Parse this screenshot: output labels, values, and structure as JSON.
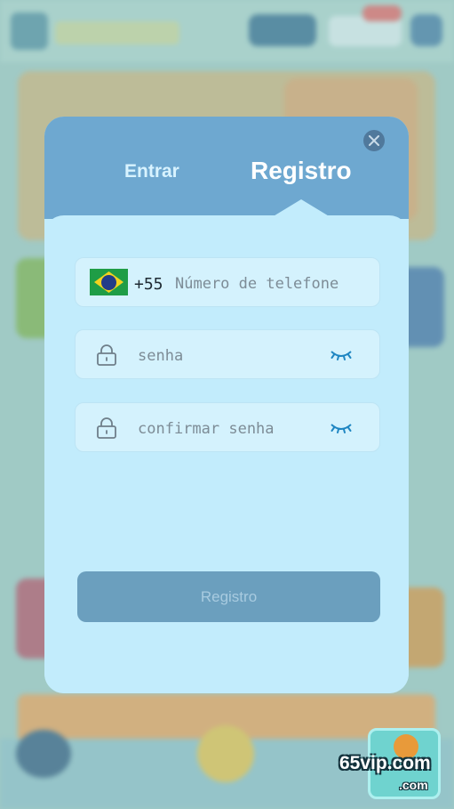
{
  "tabs": {
    "login_label": "Entrar",
    "register_label": "Registro"
  },
  "phone": {
    "country_code": "+55",
    "placeholder": "Número de telefone",
    "flag": "brazil-flag-icon"
  },
  "password": {
    "placeholder": "senha",
    "icon": "lock-icon",
    "toggle_icon": "eye-closed-icon"
  },
  "confirm_password": {
    "placeholder": "confirmar senha",
    "icon": "lock-icon",
    "toggle_icon": "eye-closed-icon"
  },
  "submit": {
    "label": "Registro"
  },
  "watermark": {
    "text": "65vip.com",
    "sub": ".com"
  },
  "colors": {
    "header": "#6ea8d0",
    "panel": "#c2ecfc",
    "button": "#6b9fbe",
    "eye_icon": "#1f86c2"
  }
}
